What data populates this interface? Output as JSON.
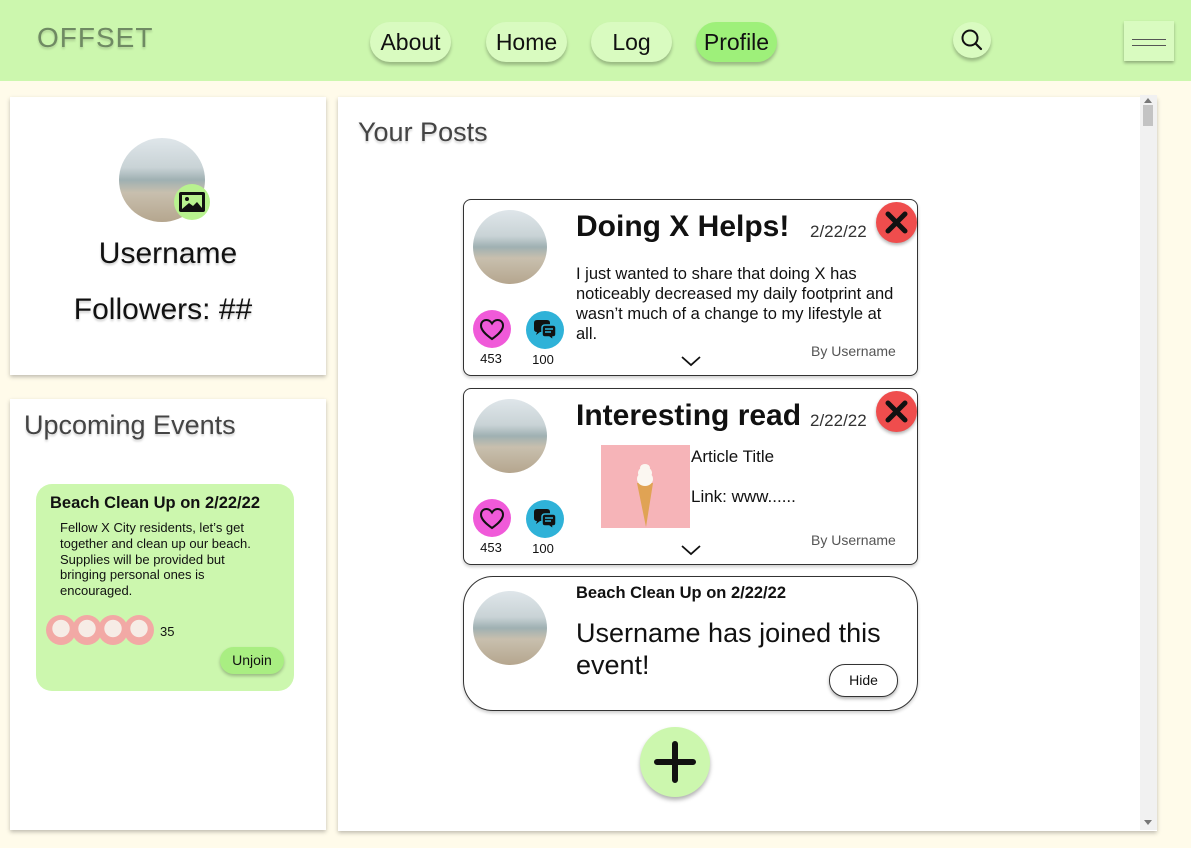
{
  "header": {
    "logo": "OFFSET",
    "nav": [
      {
        "label": "About"
      },
      {
        "label": "Home"
      },
      {
        "label": "Log"
      },
      {
        "label": "Profile",
        "active": true
      }
    ]
  },
  "profile": {
    "username": "Username",
    "followers": "Followers: ##"
  },
  "events_panel": {
    "title": "Upcoming Events",
    "event": {
      "title": "Beach Clean Up on 2/22/22",
      "description": "Fellow X City residents, let’s get together and clean up our beach.\nSupplies will be provided but bringing personal ones is encouraged.",
      "attendee_count": "35",
      "action_label": "Unjoin"
    }
  },
  "posts_panel": {
    "title": "Your Posts",
    "posts": [
      {
        "title": "Doing X Helps!",
        "date": "2/22/22",
        "body": "I just wanted to share that doing X has noticeably decreased my daily footprint and wasn’t much of a change to my lifestyle at all.",
        "likes": "453",
        "comments": "100",
        "byline": "By Username"
      },
      {
        "title": "Interesting read",
        "date": "2/22/22",
        "article_title": "Article Title",
        "article_link": "Link: www......",
        "likes": "453",
        "comments": "100",
        "byline": "By Username"
      }
    ],
    "event_post": {
      "title": "Beach Clean Up on 2/22/22",
      "message": "Username has joined this event!",
      "hide_label": "Hide"
    }
  },
  "colors": {
    "accent_green": "#ccf7ae",
    "active_green": "#9ef07a",
    "like_pink": "#f05ad9",
    "comment_blue": "#2fb2d8",
    "delete_red": "#ef4d4d"
  }
}
